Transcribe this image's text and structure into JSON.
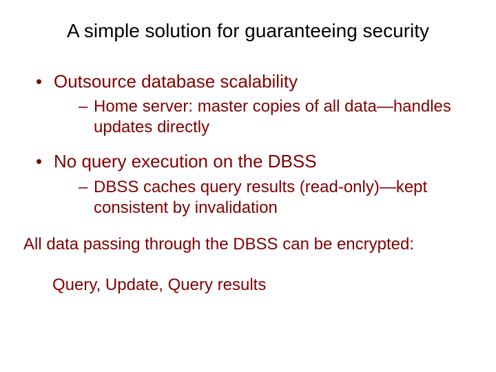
{
  "slide": {
    "title": "A simple solution for guaranteeing security",
    "bullets": [
      {
        "text": "Outsource database scalability",
        "sub": [
          "Home server: master copies of all data—handles updates directly"
        ]
      },
      {
        "text": "No query execution on the DBSS",
        "sub": [
          "DBSS caches query results (read-only)—kept consistent by invalidation"
        ]
      }
    ],
    "paragraph": "All data passing through the DBSS can be encrypted:",
    "subline": "Query, Update, Query results"
  }
}
